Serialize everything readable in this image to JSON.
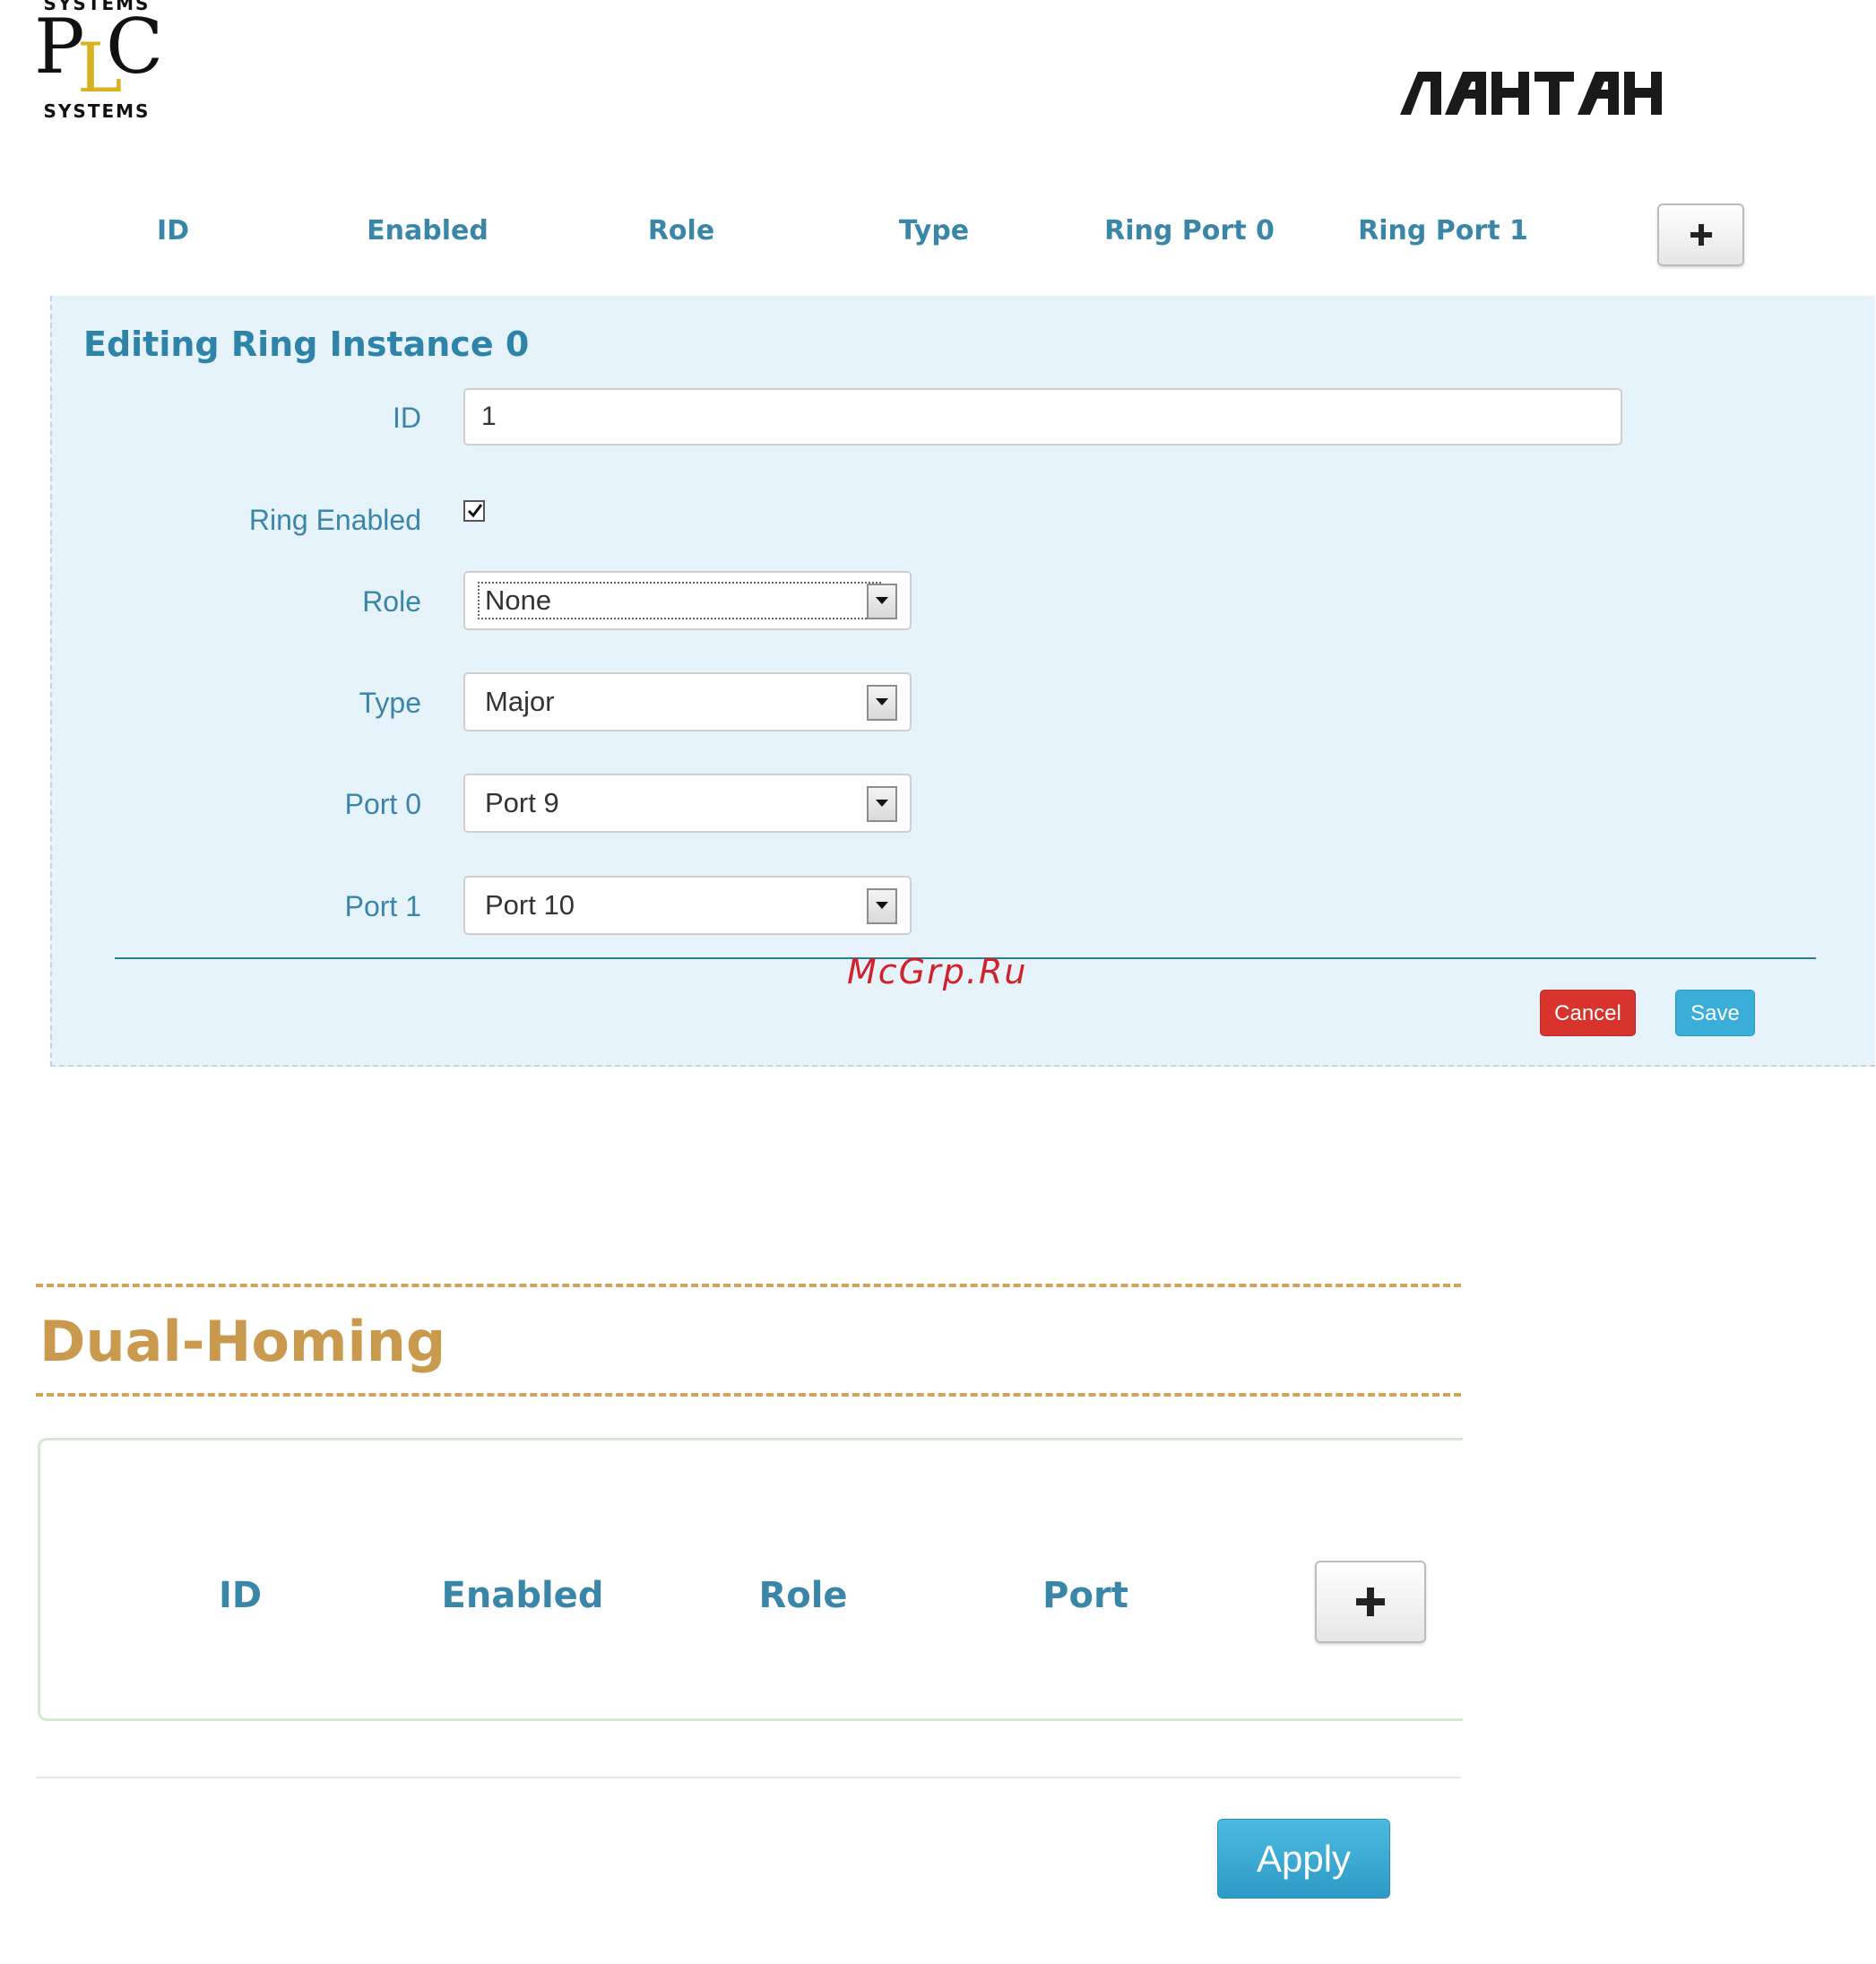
{
  "logos": {
    "plc": {
      "top_text": "SYSTEMS",
      "letter_p": "P",
      "letter_l": "L",
      "letter_c": "C",
      "bottom_text": "SYSTEMS"
    },
    "brand_text": "ЛАНТАН"
  },
  "ring_table": {
    "headers": [
      "ID",
      "Enabled",
      "Role",
      "Type",
      "Ring Port 0",
      "Ring Port 1"
    ],
    "add_button": "+"
  },
  "edit_form": {
    "title": "Editing Ring Instance 0",
    "fields": {
      "id": {
        "label": "ID",
        "value": "1"
      },
      "ring_enabled": {
        "label": "Ring Enabled",
        "checked": true
      },
      "role": {
        "label": "Role",
        "value": "None"
      },
      "type": {
        "label": "Type",
        "value": "Major"
      },
      "port0": {
        "label": "Port 0",
        "value": "Port 9"
      },
      "port1": {
        "label": "Port 1",
        "value": "Port 10"
      }
    },
    "cancel_label": "Cancel",
    "save_label": "Save"
  },
  "watermark": "McGrp.Ru",
  "dual_homing": {
    "title": "Dual-Homing",
    "headers": [
      "ID",
      "Enabled",
      "Role",
      "Port"
    ],
    "add_button": "+"
  },
  "apply_label": "Apply",
  "colors": {
    "header_blue": "#3a86a8",
    "panel_bg": "#e7f3fb",
    "cancel_red": "#d8332d",
    "save_blue": "#3aaed8",
    "dual_homing_gold": "#c99a4e",
    "logo_gold": "#d9b21f",
    "watermark_red": "#d0222a"
  }
}
